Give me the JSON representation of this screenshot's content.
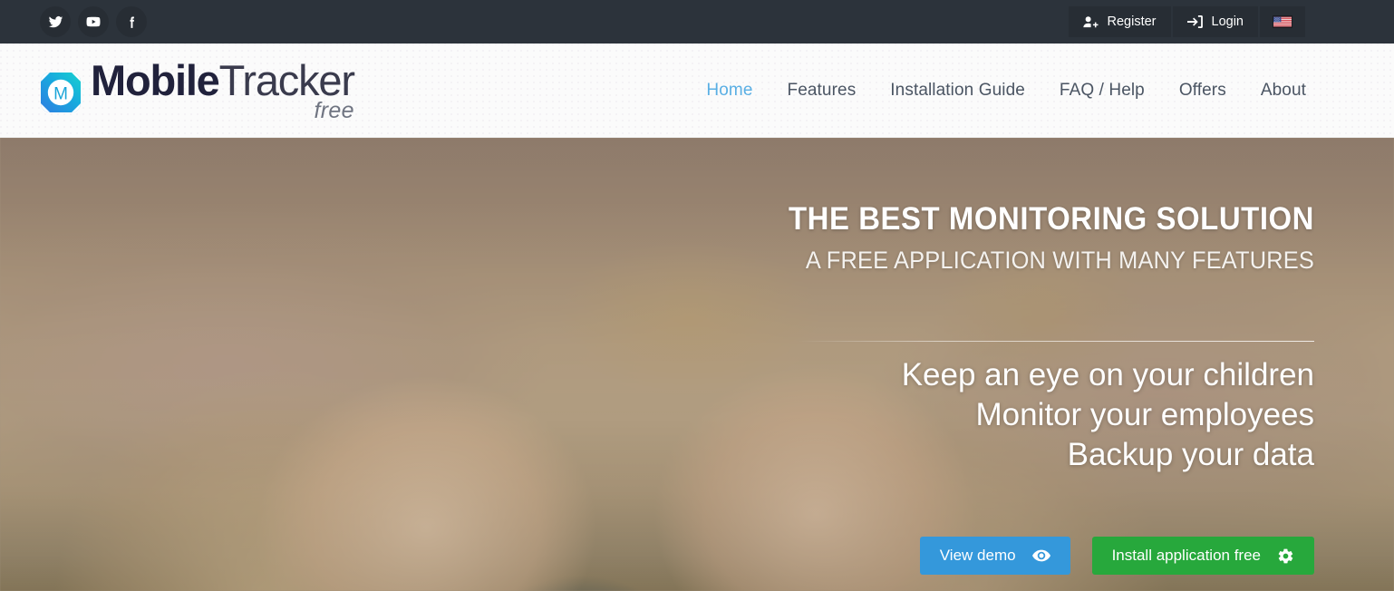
{
  "topbar": {
    "background": "#2c333b",
    "social": [
      {
        "name": "twitter",
        "label": "Twitter"
      },
      {
        "name": "youtube",
        "label": "YouTube"
      },
      {
        "name": "facebook",
        "label": "Facebook"
      }
    ],
    "register_label": "Register",
    "login_label": "Login",
    "language": "English (US)"
  },
  "header": {
    "logo": {
      "bold": "Mobile",
      "light": "Tracker",
      "tagline": "free",
      "mark_letter": "M",
      "mark_color_start": "#2f7de1",
      "mark_color_end": "#1ec8d8"
    },
    "nav": [
      {
        "label": "Home",
        "active": true
      },
      {
        "label": "Features",
        "active": false
      },
      {
        "label": "Installation Guide",
        "active": false
      },
      {
        "label": "FAQ / Help",
        "active": false
      },
      {
        "label": "Offers",
        "active": false
      },
      {
        "label": "About",
        "active": false
      }
    ],
    "active_color": "#5aafe4"
  },
  "hero": {
    "title": "THE BEST MONITORING SOLUTION",
    "subtitle": "A FREE APPLICATION WITH MANY FEATURES",
    "lines": [
      "Keep an eye on your children",
      "Monitor your employees",
      "Backup your data"
    ],
    "demo_button": "View demo",
    "install_button": "Install application free",
    "demo_color": "#3498db",
    "install_color": "#27a83c"
  }
}
